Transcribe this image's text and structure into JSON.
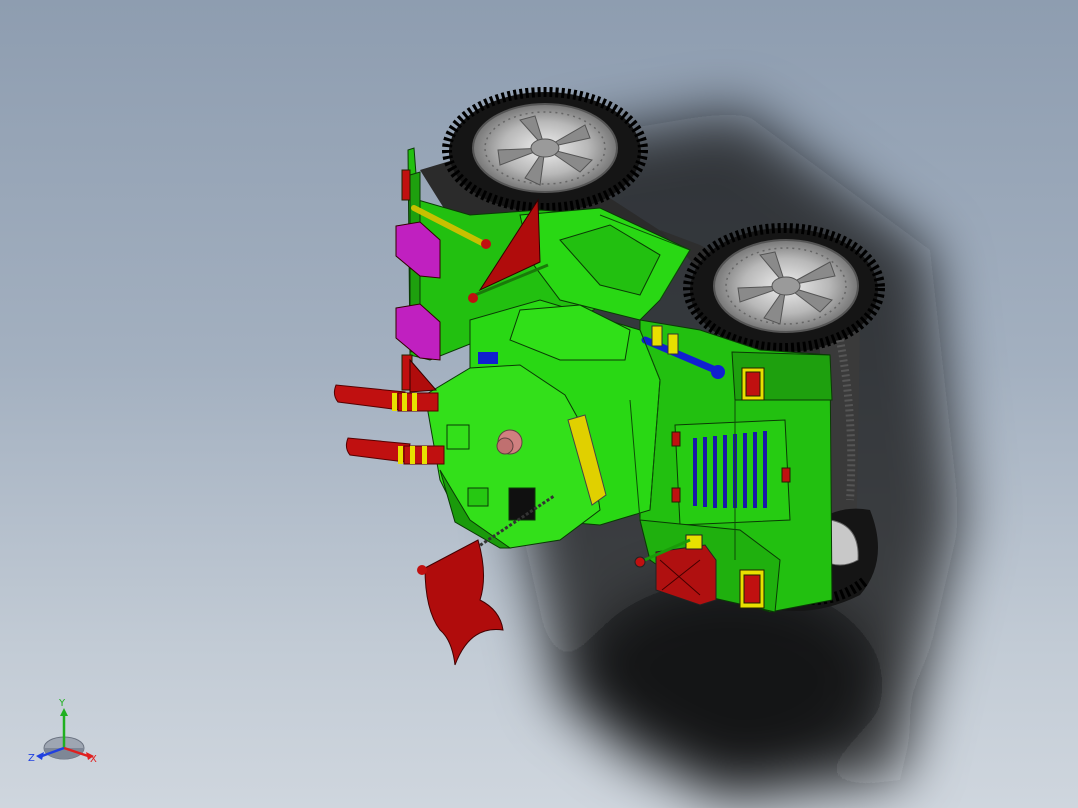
{
  "triad": {
    "x_label": "X",
    "y_label": "Y",
    "z_label": "Z",
    "x_color": "#e02020",
    "y_color": "#20b020",
    "z_color": "#2040e0"
  },
  "model": {
    "body_color": "#22d010",
    "accent_yellow": "#e8e000",
    "accent_red": "#c01010",
    "accent_magenta": "#c020c0",
    "accent_blue": "#1020d0"
  }
}
